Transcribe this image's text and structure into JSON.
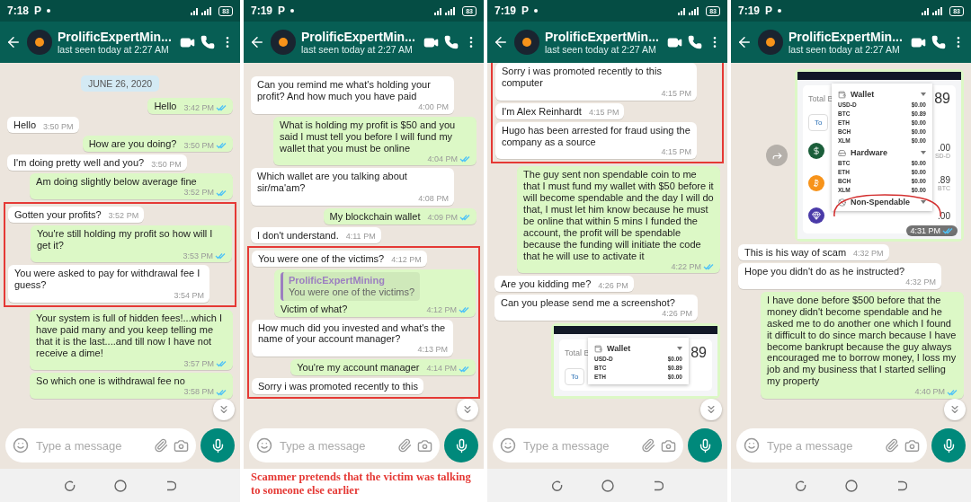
{
  "panels": [
    {
      "status": {
        "time": "7:18",
        "notification": "P",
        "battery": "83"
      },
      "header": {
        "name": "ProlificExpertMin...",
        "last_seen": "last seen today at 2:27 AM"
      },
      "messages": [
        {
          "kind": "date",
          "text": "JUNE 26, 2020"
        },
        {
          "kind": "outgoing",
          "text": "Hello",
          "time": "3:42 PM",
          "read": true
        },
        {
          "kind": "incoming",
          "text": "Hello",
          "time": "3:50 PM"
        },
        {
          "kind": "outgoing",
          "text": "How are you doing?",
          "time": "3:50 PM",
          "read": true
        },
        {
          "kind": "incoming",
          "text": "I'm doing pretty well and you?",
          "time": "3:50 PM"
        },
        {
          "kind": "outgoing",
          "text": "Am doing slightly below average fine",
          "time": "3:52 PM",
          "read": true
        },
        {
          "kind": "highlight",
          "messages": [
            {
              "kind": "incoming",
              "text": "Gotten your profits?",
              "time": "3:52 PM"
            },
            {
              "kind": "outgoing",
              "text": "You're still holding my profit so how will I get it?",
              "time": "3:53 PM",
              "read": true
            },
            {
              "kind": "incoming",
              "text": "You were asked to pay for withdrawal fee I guess?",
              "time": "3:54 PM"
            }
          ]
        },
        {
          "kind": "outgoing",
          "text": "Your system is full of hidden fees!...which I have paid many and you keep telling me that it is the last....and till now I have not receive a dime!",
          "time": "3:57 PM",
          "read": true
        },
        {
          "kind": "outgoing",
          "text": "So which one is withdrawal fee no",
          "time": "3:58 PM",
          "read": true
        }
      ],
      "input": {
        "placeholder": "Type a message"
      }
    },
    {
      "status": {
        "time": "7:19",
        "notification": "P",
        "battery": "83"
      },
      "header": {
        "name": "ProlificExpertMin...",
        "last_seen": "last seen today at 2:27 AM"
      },
      "messages": [
        {
          "kind": "incoming",
          "text": "Can you remind me what's holding your profit? And how much you have paid",
          "time": "4:00 PM"
        },
        {
          "kind": "outgoing",
          "text": "What is holding my profit is $50 and you said I must tell you before I will fund my wallet that you must be online",
          "time": "4:04 PM",
          "read": true
        },
        {
          "kind": "incoming",
          "text": "Which wallet are you talking about sir/ma'am?",
          "time": "4:08 PM"
        },
        {
          "kind": "outgoing",
          "text": "My blockchain wallet",
          "time": "4:09 PM",
          "read": true
        },
        {
          "kind": "incoming",
          "text": "I don't understand.",
          "time": "4:11 PM"
        },
        {
          "kind": "highlight",
          "messages": [
            {
              "kind": "incoming",
              "text": "You were one of the victims?",
              "time": "4:12 PM"
            },
            {
              "kind": "reply",
              "quote_author": "ProlificExpertMining",
              "quote_text": "You were one of the victims?",
              "text": "Victim of what?",
              "time": "4:12 PM",
              "read": true
            },
            {
              "kind": "incoming",
              "text": "How much did you invested and what's the name of your account manager?",
              "time": "4:13 PM"
            },
            {
              "kind": "outgoing",
              "text": "You're my account manager",
              "time": "4:14 PM",
              "read": true
            },
            {
              "kind": "incoming",
              "text": "Sorry i was promoted recently to this"
            }
          ]
        }
      ],
      "input": {
        "placeholder": "Type a message"
      },
      "caption": "Scammer pretends that the victim was talking to someone else earlier"
    },
    {
      "status": {
        "time": "7:19",
        "notification": "P",
        "battery": "83"
      },
      "header": {
        "name": "ProlificExpertMin...",
        "last_seen": "last seen today at 2:27 AM"
      },
      "messages": [
        {
          "kind": "highlight",
          "messages": [
            {
              "kind": "incoming",
              "text": "Sorry i was promoted recently to this computer",
              "time": "4:15 PM"
            },
            {
              "kind": "incoming",
              "text": "I'm Alex Reinhardt",
              "time": "4:15 PM"
            },
            {
              "kind": "incoming",
              "text": "Hugo has been arrested for fraud using the company as a source",
              "time": "4:15 PM"
            }
          ]
        },
        {
          "kind": "outgoing",
          "text": "The guy sent non spendable coin to me that I must fund my wallet with $50 before it will become spendable and the day I will do that, I must let him know because he must be online that within 5 mins I funded the account, the profit will be spendable because the funding will initiate the code that he will use to activate it",
          "time": "4:22 PM",
          "read": true
        },
        {
          "kind": "incoming",
          "text": "Are you kidding me?",
          "time": "4:26 PM"
        },
        {
          "kind": "incoming",
          "text": "Can you please send me a screenshot?",
          "time": "4:26 PM"
        },
        {
          "kind": "screenshot",
          "total_label": "Total B",
          "total_value": "89",
          "button_label": "To",
          "sections": [
            {
              "kind": "wallet",
              "title": "Wallet",
              "rows": [
                {
                  "coin": "USD-D",
                  "amount": "$0.00"
                },
                {
                  "coin": "BTC",
                  "amount": "$0.89"
                },
                {
                  "coin": "ETH",
                  "amount": "$0.00"
                }
              ]
            }
          ]
        }
      ],
      "input": {
        "placeholder": "Type a message"
      }
    },
    {
      "status": {
        "time": "7:19",
        "notification": "P",
        "battery": "83"
      },
      "header": {
        "name": "ProlificExpertMin...",
        "last_seen": "last seen today at 2:27 AM"
      },
      "messages": [
        {
          "kind": "screenshot",
          "forward_button": true,
          "total_label": "Total B",
          "total_value": "89",
          "button_label": "To",
          "time": "4:31 PM",
          "read": true,
          "coins": [
            {
              "color": "#1b5e3a",
              "amount": ".00",
              "unit": "SD-D"
            },
            {
              "color": "#f7931a",
              "amount": ".89",
              "unit": "BTC"
            },
            {
              "color": "#4a3aa8",
              "amount": ".00"
            }
          ],
          "sections": [
            {
              "kind": "wallet",
              "title": "Wallet",
              "rows": [
                {
                  "coin": "USD-D",
                  "amount": "$0.00"
                },
                {
                  "coin": "BTC",
                  "amount": "$0.89"
                },
                {
                  "coin": "ETH",
                  "amount": "$0.00"
                },
                {
                  "coin": "BCH",
                  "amount": "$0.00"
                },
                {
                  "coin": "XLM",
                  "amount": "$0.00"
                }
              ]
            },
            {
              "kind": "hardware",
              "title": "Hardware",
              "rows": [
                {
                  "coin": "BTC",
                  "amount": "$0.00"
                },
                {
                  "coin": "ETH",
                  "amount": "$0.00"
                },
                {
                  "coin": "BCH",
                  "amount": "$0.00"
                },
                {
                  "coin": "XLM",
                  "amount": "$0.00"
                }
              ]
            },
            {
              "kind": "blocked",
              "title": "Non-Spendable",
              "circled": true
            }
          ]
        },
        {
          "kind": "incoming",
          "text": "This is his way of scam",
          "time": "4:32 PM"
        },
        {
          "kind": "incoming",
          "text": "Hope you didn't do as he instructed?",
          "time": "4:32 PM"
        },
        {
          "kind": "outgoing",
          "text": "I have done before $500 before that the money didn't become spendable and he asked me to do another one which I found it difficult to do since march because I have become bankrupt because the guy always encouraged me to borrow money, I loss my job and my business that I started selling my property",
          "time": "4:40 PM",
          "read": true
        }
      ],
      "input": {
        "placeholder": "Type a message"
      }
    }
  ]
}
